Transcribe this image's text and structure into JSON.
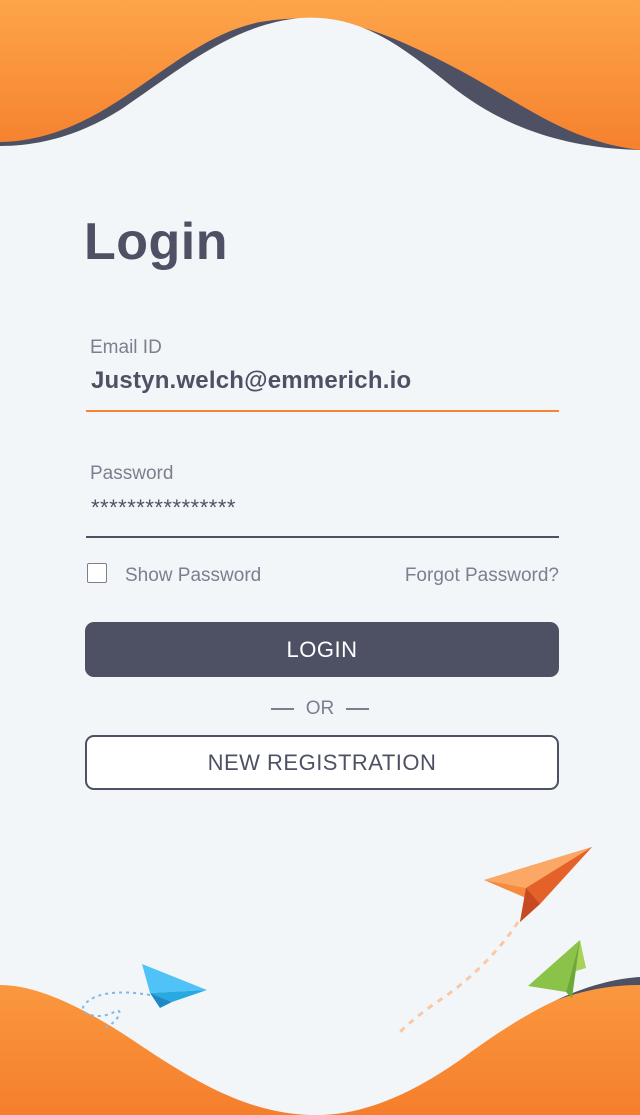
{
  "login": {
    "title": "Login",
    "email": {
      "label": "Email ID",
      "value": "Justyn.welch@emmerich.io"
    },
    "password": {
      "label": "Password",
      "value": "****************"
    },
    "show_password_label": "Show Password",
    "show_password_checked": false,
    "forgot_password_label": "Forgot Password?",
    "login_button_label": "LOGIN",
    "or_label": "OR",
    "register_button_label": "NEW REGISTRATION"
  },
  "colors": {
    "background": "#f3f6f9",
    "accent_orange": "#f58434",
    "dark_slate": "#4e5163",
    "muted_text": "#7c7f8e"
  },
  "decorations": {
    "icons": [
      "paper-plane-orange-icon",
      "paper-plane-green-icon",
      "paper-plane-blue-icon"
    ]
  }
}
